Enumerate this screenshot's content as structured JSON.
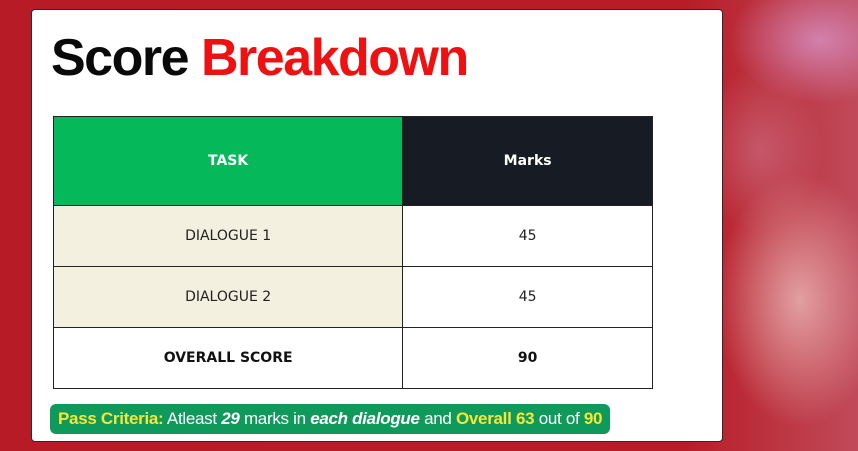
{
  "header": {
    "title_part1": "Score",
    "title_part2": "Breakdown"
  },
  "table": {
    "headers": [
      "TASK",
      "Marks"
    ],
    "rows": [
      {
        "task": "DIALOGUE 1",
        "marks": "45"
      },
      {
        "task": "DIALOGUE 2",
        "marks": "45"
      },
      {
        "task": "OVERALL SCORE",
        "marks": "90"
      }
    ]
  },
  "criteria": {
    "label": "Pass Criteria:",
    "text1": " Atleast ",
    "num1": "29",
    "text2": " marks in ",
    "emph": "each dialogue",
    "text3": " and ",
    "overall": "Overall 63",
    "text4": " out of ",
    "total": "90"
  },
  "colors": {
    "background": "#b71c26",
    "title_accent": "#ee1111",
    "task_header": "#05b95b",
    "marks_header": "#161b24",
    "task_cell": "#f3f0e0",
    "criteria_bg": "#0f9a5c",
    "criteria_highlight": "#f5e63a"
  }
}
